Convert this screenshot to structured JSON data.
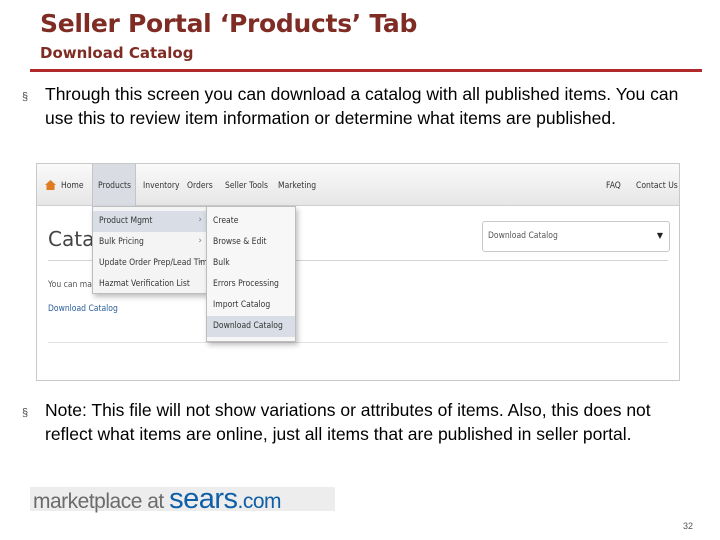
{
  "slide": {
    "title": "Seller Portal ‘Products’ Tab",
    "subtitle": "Download Catalog",
    "bullets": [
      "Through this screen you can download a catalog with all published items. You can use this to review item information or determine what items are published.",
      "Note: This file will not show variations or attributes of items. Also, this does not reflect what items are online, just all items that are published in seller portal."
    ],
    "bullet_marker": "§",
    "page_number": "32"
  },
  "portal": {
    "nav": {
      "home": "Home",
      "products": "Products",
      "inventory": "Inventory",
      "orders": "Orders",
      "seller_tools": "Seller Tools",
      "marketing": "Marketing",
      "faq": "FAQ",
      "contact_us": "Contact Us"
    },
    "page_heading": "Catalog",
    "intro_text": "You can mana",
    "download_link": "Download Catalog",
    "select_value": "Download Catalog",
    "select_arrow": "▼",
    "menu_level1": [
      {
        "label": "Product Mgmt",
        "chevron": "›"
      },
      {
        "label": "Bulk Pricing",
        "chevron": "›"
      },
      {
        "label": "Update Order Prep/Lead Time",
        "chevron": "›"
      },
      {
        "label": "Hazmat Verification List",
        "chevron": ""
      }
    ],
    "menu_level2": [
      "Create",
      "Browse & Edit",
      "Bulk",
      "Errors Processing",
      "Import Catalog",
      "Download Catalog"
    ]
  },
  "logo": {
    "prefix": "marketplace at ",
    "brand": "sears",
    "suffix": ".com"
  },
  "colors": {
    "title": "#7f2c25",
    "rule": "#b02a2c",
    "link": "#2a5d9a",
    "brand_blue": "#0f5fa8"
  }
}
